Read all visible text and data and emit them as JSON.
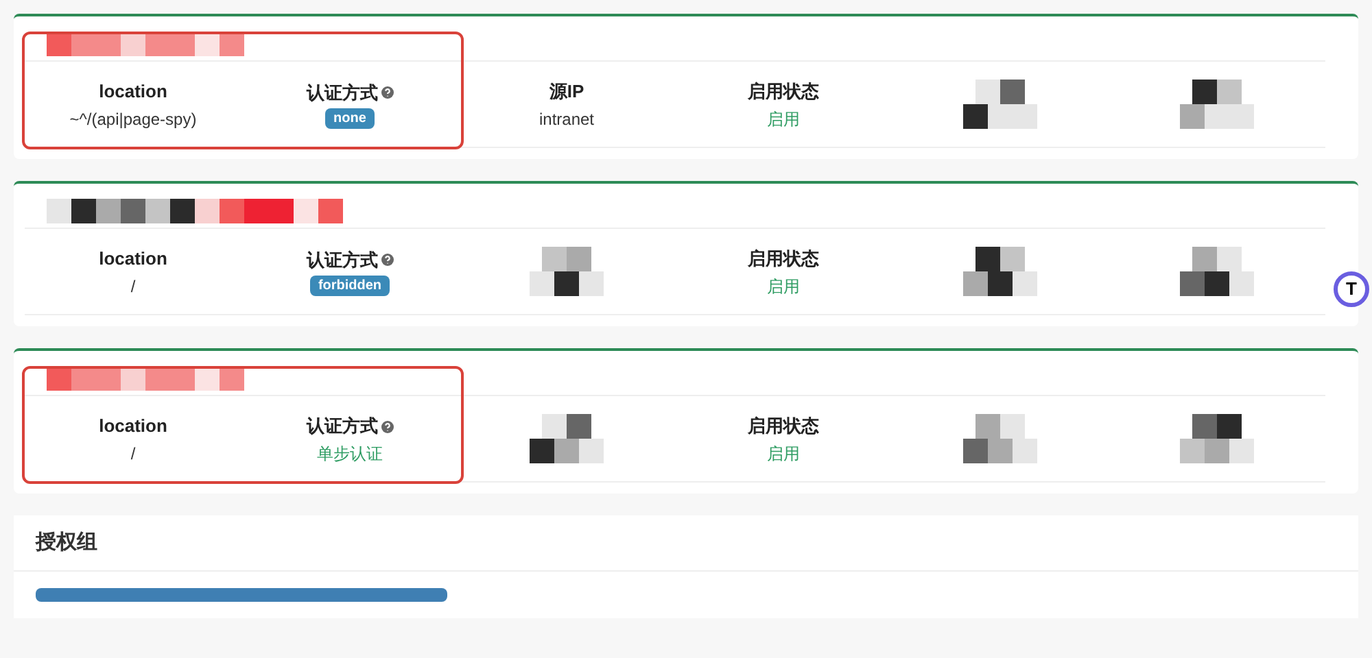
{
  "cards": [
    {
      "highlighted": true,
      "fields": [
        {
          "kind": "text",
          "label": "location",
          "value": "~^/(api|page-spy)"
        },
        {
          "kind": "badge",
          "label": "认证方式",
          "help": true,
          "value": "none"
        },
        {
          "kind": "text",
          "label": "源IP",
          "value": "intranet"
        },
        {
          "kind": "status",
          "label": "启用状态",
          "value": "启用"
        },
        {
          "kind": "redacted"
        },
        {
          "kind": "redacted"
        }
      ]
    },
    {
      "highlighted": false,
      "fields": [
        {
          "kind": "text",
          "label": "location",
          "value": "/"
        },
        {
          "kind": "badge",
          "label": "认证方式",
          "help": true,
          "value": "forbidden"
        },
        {
          "kind": "redacted"
        },
        {
          "kind": "status",
          "label": "启用状态",
          "value": "启用"
        },
        {
          "kind": "redacted"
        },
        {
          "kind": "redacted"
        }
      ]
    },
    {
      "highlighted": true,
      "fields": [
        {
          "kind": "text",
          "label": "location",
          "value": "/"
        },
        {
          "kind": "status",
          "label": "认证方式",
          "help": true,
          "value": "单步认证"
        },
        {
          "kind": "redacted"
        },
        {
          "kind": "status",
          "label": "启用状态",
          "value": "启用"
        },
        {
          "kind": "redacted"
        },
        {
          "kind": "redacted"
        }
      ]
    }
  ],
  "section": {
    "title": "授权组"
  },
  "floating_button": {
    "label": "T"
  }
}
